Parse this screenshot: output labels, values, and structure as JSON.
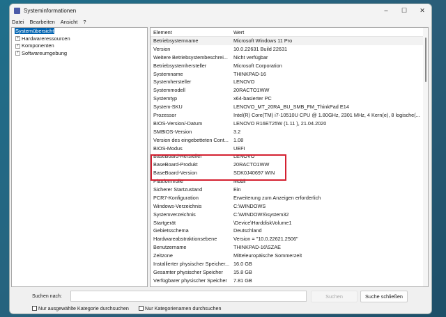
{
  "window": {
    "title": "Systeminformationen",
    "controls": {
      "minimize": "–",
      "maximize": "☐",
      "close": "✕"
    }
  },
  "menu": [
    "Datei",
    "Bearbeiten",
    "Ansicht",
    "?"
  ],
  "tree": {
    "root": "Systemübersicht",
    "children": [
      "Hardwareressourcen",
      "Komponenten",
      "Softwareumgebung"
    ]
  },
  "table": {
    "headers": [
      "Element",
      "Wert"
    ],
    "rows": [
      [
        "Betriebsystemname",
        "Microsoft Windows 11 Pro"
      ],
      [
        "Version",
        "10.0.22631 Build 22631"
      ],
      [
        "Weitere Betriebsystembeschrei...",
        "Nicht verfügbar"
      ],
      [
        "Betriebsystemhersteller",
        "Microsoft Corporation"
      ],
      [
        "Systemname",
        "THINKPAD-16"
      ],
      [
        "Systemhersteller",
        "LENOVO"
      ],
      [
        "Systemmodell",
        "20RACTO1WW"
      ],
      [
        "Systemtyp",
        "x64-basierter PC"
      ],
      [
        "System-SKU",
        "LENOVO_MT_20RA_BU_SMB_FM_ThinkPad E14"
      ],
      [
        "Prozessor",
        "Intel(R) Core(TM) i7-10510U CPU @ 1.80GHz, 2301 MHz, 4 Kern(e), 8 logische(..."
      ],
      [
        "BIOS-Version/-Datum",
        "LENOVO R16ET25W (1.11 ), 21.04.2020"
      ],
      [
        "SMBIOS-Version",
        "3.2"
      ],
      [
        "Version des eingebetteten Cont...",
        "1.08"
      ],
      [
        "BIOS-Modus",
        "UEFI"
      ],
      [
        "BaseBoard-Hersteller",
        "LENOVO"
      ],
      [
        "BaseBoard-Produkt",
        "20RACTO1WW"
      ],
      [
        "BaseBoard-Version",
        "SDK0J40697 WIN"
      ],
      [
        "Plattformrolle",
        "Mobil"
      ],
      [
        "Sicherer Startzustand",
        "Ein"
      ],
      [
        "PCR7-Konfiguration",
        "Erweiterung zum Anzeigen erforderlich"
      ],
      [
        "Windows-Verzeichnis",
        "C:\\WINDOWS"
      ],
      [
        "Systemverzeichnis",
        "C:\\WINDOWS\\system32"
      ],
      [
        "Startgerät",
        "\\Device\\HarddiskVolume1"
      ],
      [
        "Gebietsschema",
        "Deutschland"
      ],
      [
        "Hardwareabstraktionsebene",
        "Version = \"10.0.22621.2506\""
      ],
      [
        "Benutzername",
        "THINKPAD-16\\SZAE"
      ],
      [
        "Zeitzone",
        "Mitteleuropäische Sommerzeit"
      ],
      [
        "Installierter physischer Speicher...",
        "16.0 GB"
      ],
      [
        "Gesamter physischer Speicher",
        "15.8 GB"
      ],
      [
        "Verfügbarer physischer Speicher",
        "7.81 GB"
      ]
    ]
  },
  "search": {
    "label": "Suchen nach:",
    "value": "",
    "search_button": "Suchen",
    "close_button": "Suche schließen",
    "check1": "Nur ausgewählte Kategorie durchsuchen",
    "check2": "Nur Kategorienamen durchsuchen"
  },
  "colors": {
    "highlight": "#d42030",
    "selection": "#0063b1"
  }
}
